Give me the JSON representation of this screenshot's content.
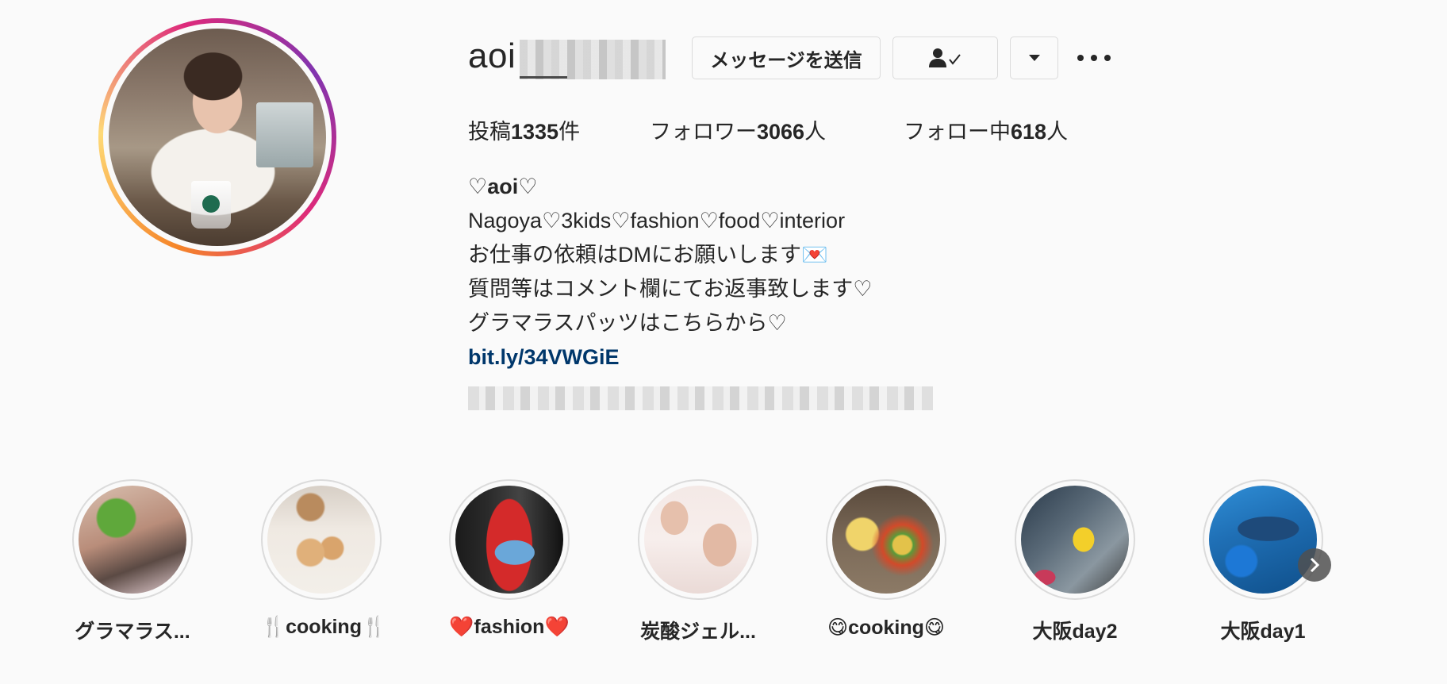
{
  "profile": {
    "username": "aoi",
    "message_button": "メッセージを送信",
    "following_icon_label": "👤✓",
    "dropdown_icon": "▾"
  },
  "stats": {
    "posts": "投稿1335件",
    "posts_prefix": "投稿",
    "posts_count": "1335",
    "posts_suffix": "件",
    "followers_prefix": "フォロワー",
    "followers_count": "3066",
    "followers_suffix": "人",
    "following_prefix": "フォロー中",
    "following_count": "618",
    "following_suffix": "人"
  },
  "bio": {
    "name": "♡aoi♡",
    "line1": "Nagoya♡3kids♡fashion♡food♡interior",
    "line2": "お仕事の依頼はDMにお願いします💌",
    "line3": "質問等はコメント欄にてお返事致します♡",
    "line4": "グラマラスパッツはこちらから♡",
    "link": "bit.ly/34VWGiE"
  },
  "highlights": [
    {
      "label": "グラマラス..."
    },
    {
      "label": "🍴cooking🍴"
    },
    {
      "label": "❤️fashion❤️"
    },
    {
      "label": "炭酸ジェル..."
    },
    {
      "label": "😋cooking😋"
    },
    {
      "label": "大阪day2"
    },
    {
      "label": "大阪day1"
    }
  ],
  "colors": {
    "link": "#00376b",
    "story_ring": "#dd2a7b",
    "background": "#fafafa"
  }
}
